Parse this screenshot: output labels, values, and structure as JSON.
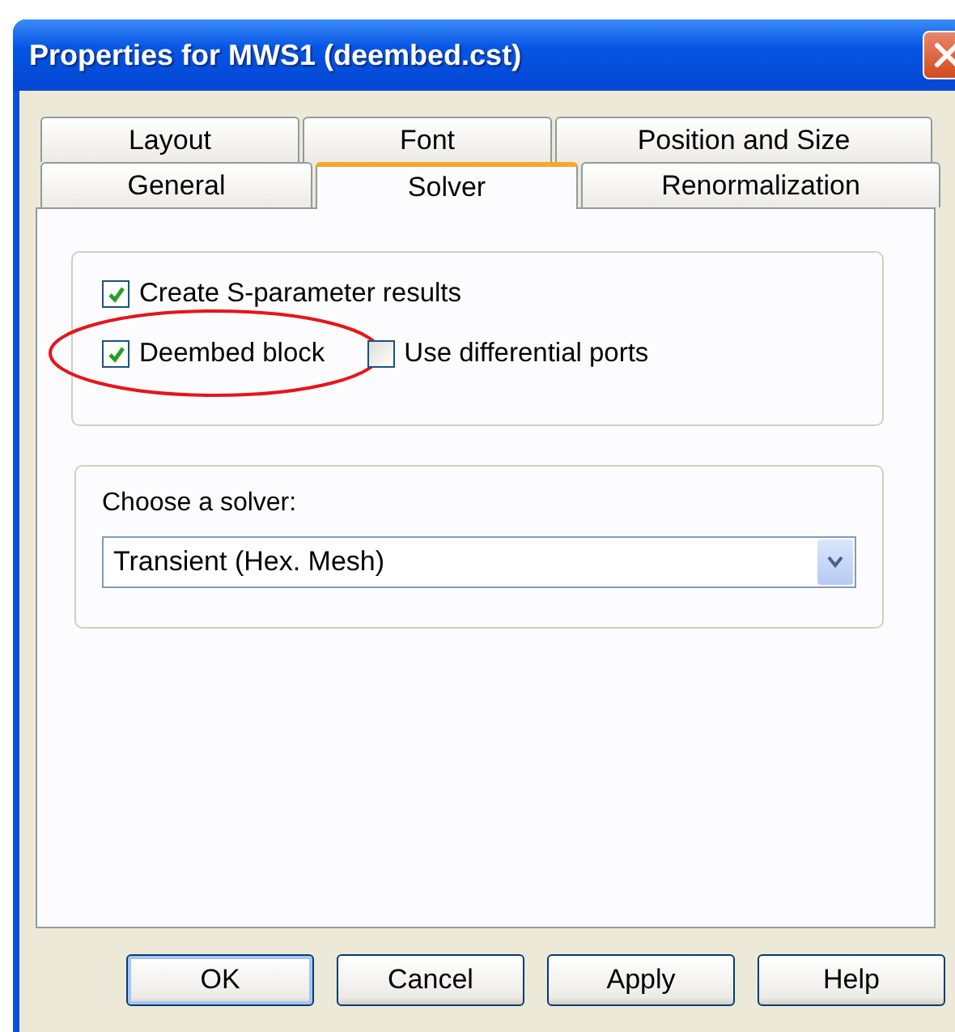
{
  "window": {
    "title": "Properties for MWS1 (deembed.cst)"
  },
  "tab_rows": [
    [
      {
        "label": "Layout",
        "selected": false
      },
      {
        "label": "Font",
        "selected": false
      },
      {
        "label": "Position and Size",
        "selected": false
      }
    ],
    [
      {
        "label": "General",
        "selected": false
      },
      {
        "label": "Solver",
        "selected": true
      },
      {
        "label": "Renormalization",
        "selected": false
      }
    ]
  ],
  "options": [
    [
      {
        "label": "Create S-parameter results",
        "checked": true,
        "circled": false
      }
    ],
    [
      {
        "label": "Deembed block",
        "checked": true,
        "circled": true
      },
      {
        "label": "Use differential ports",
        "checked": false,
        "circled": false
      }
    ]
  ],
  "solver": {
    "label": "Choose a solver:",
    "value": "Transient (Hex. Mesh)"
  },
  "buttons": [
    {
      "label": "OK",
      "default": true
    },
    {
      "label": "Cancel",
      "default": false
    },
    {
      "label": "Apply",
      "default": false
    },
    {
      "label": "Help",
      "default": false
    }
  ]
}
